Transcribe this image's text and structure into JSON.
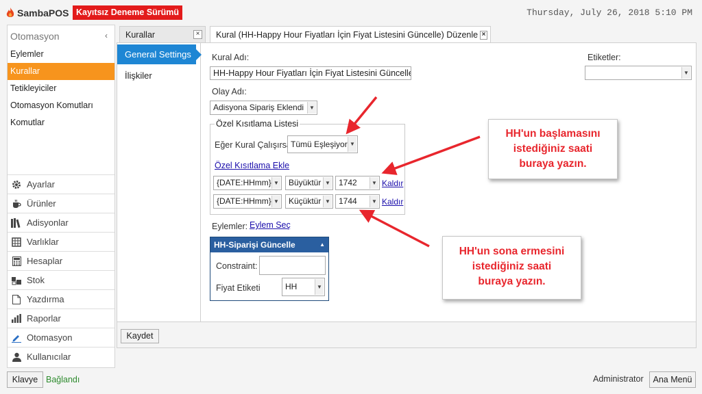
{
  "header": {
    "brand": "SambaPOS",
    "trial_badge": "Kayıtsız Deneme Sürümü",
    "datetime": "Thursday, July 26, 2018 5:10 PM"
  },
  "sidebar": {
    "title": "Otomasyon",
    "collapse_glyph": "‹",
    "items": [
      {
        "label": "Eylemler"
      },
      {
        "label": "Kurallar",
        "active": true
      },
      {
        "label": "Tetikleyiciler"
      },
      {
        "label": "Otomasyon Komutları"
      },
      {
        "label": "Komutlar"
      }
    ],
    "modules": [
      {
        "label": "Ayarlar",
        "icon": "gear-icon"
      },
      {
        "label": "Ürünler",
        "icon": "coffee-cup-icon"
      },
      {
        "label": "Adisyonlar",
        "icon": "books-icon"
      },
      {
        "label": "Varlıklar",
        "icon": "table-icon"
      },
      {
        "label": "Hesaplar",
        "icon": "calculator-icon"
      },
      {
        "label": "Stok",
        "icon": "stock-icon"
      },
      {
        "label": "Yazdırma",
        "icon": "document-icon"
      },
      {
        "label": "Raporlar",
        "icon": "bar-chart-icon"
      },
      {
        "label": "Otomasyon",
        "icon": "pencil-icon",
        "active": true
      },
      {
        "label": "Kullanıcılar",
        "icon": "user-icon"
      }
    ]
  },
  "tabs": [
    {
      "label": "Kurallar"
    },
    {
      "label": "Kural (HH-Happy Hour Fiyatları İçin Fiyat Listesini Güncelle) Düzenle",
      "active": true
    }
  ],
  "vertical_tabs": {
    "general": "General Settings",
    "relations": "İlişkiler"
  },
  "form": {
    "rule_name_label": "Kural Adı:",
    "rule_name_value": "HH-Happy Hour Fiyatları İçin Fiyat Listesini Güncelle",
    "tags_label": "Etiketler:",
    "tags_value": "",
    "event_label": "Olay Adı:",
    "event_value": "Adisyona Sipariş Eklendi",
    "constraint_group_title": "Özel Kısıtlama Listesi",
    "run_if_label": "Eğer Kural Çalışırsa",
    "run_if_value": "Tümü Eşleşiyor",
    "add_constraint_link": "Özel Kısıtlama Ekle",
    "constraints": [
      {
        "field": "{DATE:HHmm}",
        "operator": "Büyüktür",
        "value": "1742",
        "remove": "Kaldır"
      },
      {
        "field": "{DATE:HHmm}",
        "operator": "Küçüktür",
        "value": "1744",
        "remove": "Kaldır"
      }
    ],
    "actions_label": "Eylemler:",
    "select_action_link": "Eylem Seç",
    "action_card": {
      "title": "HH-Siparişi Güncelle",
      "constraint_label": "Constraint:",
      "constraint_value": "",
      "price_tag_label": "Fiyat Etiketi",
      "price_tag_value": "HH"
    }
  },
  "callouts": {
    "start": [
      "HH'un başlamasını",
      "istediğiniz saati",
      "buraya yazın."
    ],
    "end": [
      "HH'un sona ermesini",
      "istediğiniz saati",
      "buraya yazın."
    ]
  },
  "footer": {
    "save_button": "Kaydet",
    "keyboard_button": "Klavye",
    "status": "Bağlandı",
    "user": "Administrator",
    "main_menu_button": "Ana Menü"
  },
  "colors": {
    "accent_orange": "#f7941d",
    "tab_blue": "#1e86d4",
    "badge_red": "#e31b1b",
    "callout_red": "#e8262d",
    "status_green": "#2e8b2e"
  }
}
